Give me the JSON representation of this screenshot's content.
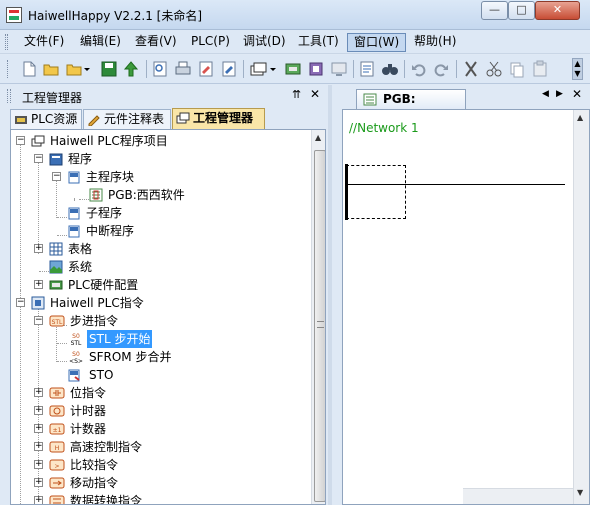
{
  "window": {
    "title": "HaiwellHappy V2.2.1 [未命名]"
  },
  "menu": {
    "items": [
      {
        "label": "文件(F)"
      },
      {
        "label": "编辑(E)"
      },
      {
        "label": "查看(V)"
      },
      {
        "label": "PLC(P)"
      },
      {
        "label": "调试(D)"
      },
      {
        "label": "工具(T)"
      },
      {
        "label": "窗口(W)"
      },
      {
        "label": "帮助(H)"
      }
    ]
  },
  "toolbar": {
    "icons": [
      "new-file-icon",
      "open-file-icon",
      "open-dropdown-icon",
      "save-icon",
      "download-icon",
      "zoom-icon",
      "print-icon",
      "edit-icon",
      "edit2-icon",
      "layers-icon",
      "plc-icon",
      "module-icon",
      "monitor-icon",
      "checklist-icon",
      "binoculars-icon",
      "undo-icon",
      "redo-icon",
      "cut-icon",
      "copy-icon",
      "paste-icon"
    ]
  },
  "left_panel": {
    "title": "工程管理器",
    "tabs": [
      {
        "label": "PLC资源"
      },
      {
        "label": "元件注释表"
      },
      {
        "label": "工程管理器"
      }
    ],
    "tree": [
      {
        "label": "Haiwell PLC程序项目"
      },
      {
        "label": "程序"
      },
      {
        "label": "主程序块"
      },
      {
        "label": "PGB:西西软件"
      },
      {
        "label": "子程序"
      },
      {
        "label": "中断程序"
      },
      {
        "label": "表格"
      },
      {
        "label": "系统"
      },
      {
        "label": "PLC硬件配置"
      },
      {
        "label": "Haiwell PLC指令"
      },
      {
        "label": "步进指令"
      },
      {
        "label": "STL 步开始"
      },
      {
        "label": "SFROM 步合并"
      },
      {
        "label": "STO"
      },
      {
        "label": "位指令"
      },
      {
        "label": "计时器"
      },
      {
        "label": "计数器"
      },
      {
        "label": "高速控制指令"
      },
      {
        "label": "比较指令"
      },
      {
        "label": "移动指令"
      },
      {
        "label": "数据转换指令"
      }
    ]
  },
  "editor": {
    "tab_label": "PGB:",
    "network_label": "//Network 1"
  },
  "colors": {
    "selection": "#3399ff",
    "network_comment": "#1a9a1a",
    "active_tab": "#f9e6a8"
  }
}
